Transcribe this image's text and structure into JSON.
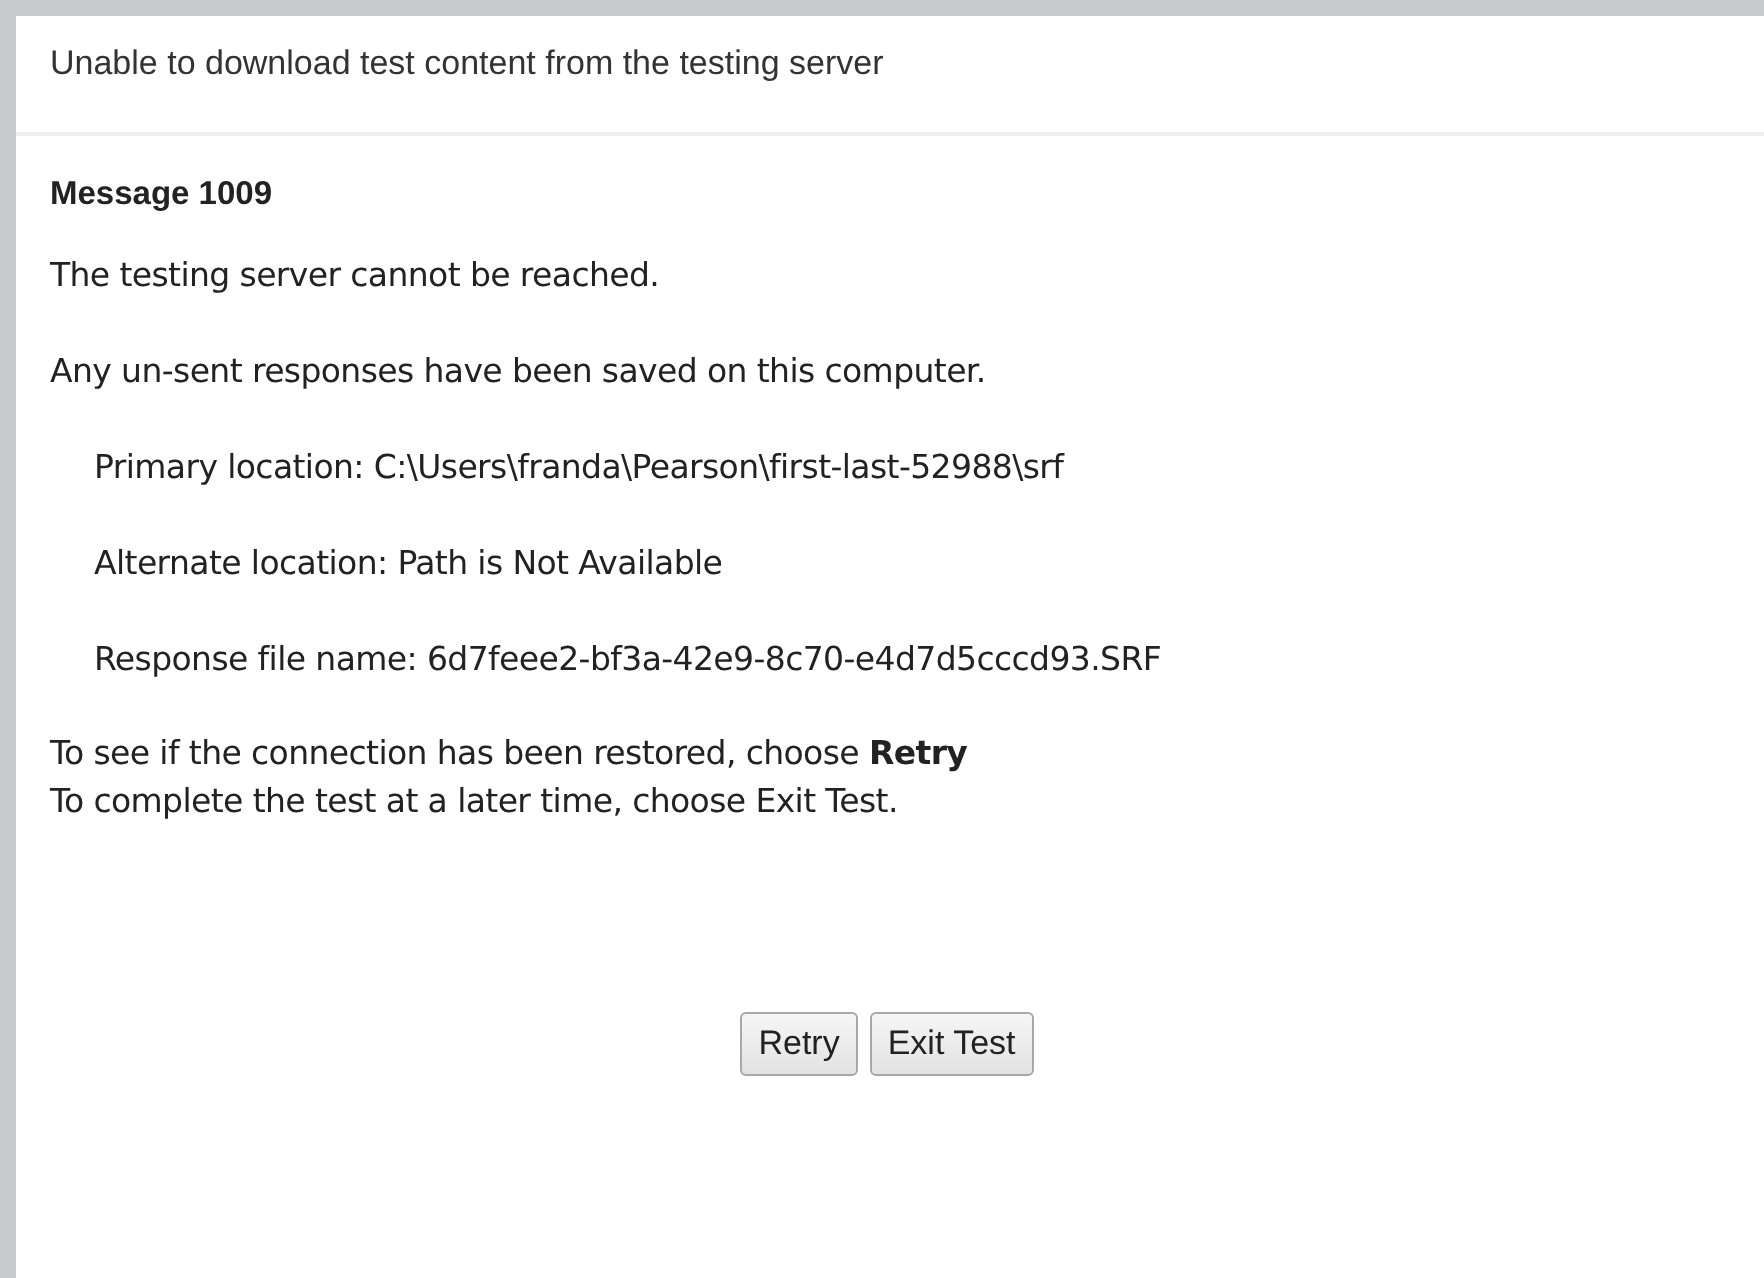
{
  "dialog": {
    "title": "Unable to download test content from the testing server"
  },
  "message": {
    "heading": "Message 1009",
    "paragraphs": [
      {
        "kind": "plain",
        "text": "The testing server cannot be reached."
      },
      {
        "kind": "plain",
        "text": "Any un-sent responses have been saved on this computer."
      },
      {
        "kind": "indented",
        "text": "Primary location: C:\\Users\\franda\\Pearson\\first-last-52988\\srf"
      },
      {
        "kind": "indented",
        "text": "Alternate location: Path is Not Available"
      },
      {
        "kind": "indented",
        "text": "Response file name: 6d7feee2-bf3a-42e9-8c70-e4d7d5cccd93.SRF"
      }
    ],
    "instructions": [
      "To see if the connection has been restored, choose **Retry**",
      "To complete the test at a later time, choose Exit Test."
    ]
  },
  "buttons": [
    "Retry",
    "Exit Test"
  ]
}
